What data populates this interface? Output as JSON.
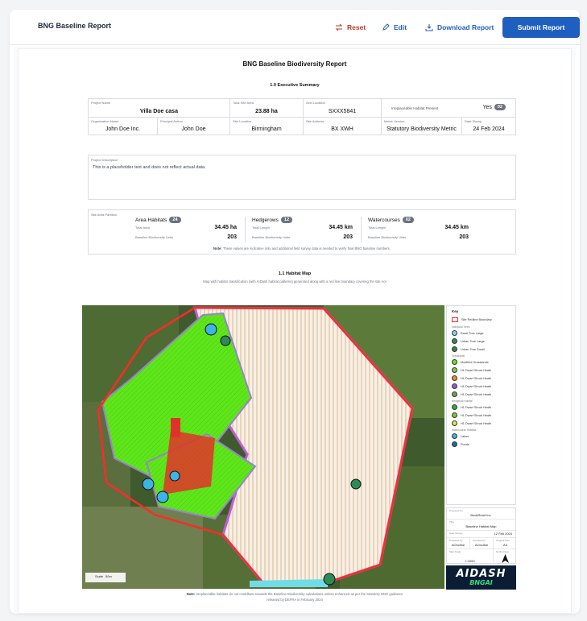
{
  "header": {
    "title": "BNG Baseline Report",
    "reset_label": "Reset",
    "edit_label": "Edit",
    "download_label": "Download Report",
    "submit_label": "Submit Report",
    "reset_color": "#c0392b",
    "accent_color": "#1f5fbf"
  },
  "report": {
    "title": "BNG Baseline Biodiversity Report",
    "section_exec": "1.0 Executive Summary",
    "project_name_label": "Project Name",
    "project_name": "Villa Doe casa",
    "total_site_area_label": "Total Site Area",
    "total_site_area": "23.88 ha",
    "grid_location_label": "Grid Location",
    "grid_location": "SXXX5841",
    "irreplaceable_label": "Irreplaceable Habitat Present",
    "irreplaceable_value": "Yes",
    "irreplaceable_count": "02",
    "org_name_label": "Organisation Name",
    "org_name": "John Doe Inc.",
    "principal_author_label": "Principal Author",
    "principal_author": "John Doe",
    "site_location_label": "Site Location",
    "site_location": "Birmingham",
    "site_address_label": "Site Address",
    "site_address": "BX XWH",
    "metric_version_label": "Metric Version",
    "metric_version": "Statutory Biodiversity Metric",
    "date_stamp_label": "Date Stamp",
    "date_stamp": "24 Feb 2024",
    "project_desc_label": "Project Description",
    "project_desc": "This is a placeholder text and does not reflect actual data.",
    "site_partition_label": "Site Area Partition",
    "partition": {
      "area_title": "Area Habitats",
      "area_count": "24",
      "area_sub1": "Total Area",
      "area_val1": "34.45 ha",
      "area_sub2": "Baseline Biodiversity Units",
      "area_val2": "203",
      "hedge_title": "Hedgerows",
      "hedge_count": "12",
      "hedge_sub1": "Total Length",
      "hedge_val1": "34.45 km",
      "hedge_sub2": "Baseline Biodiversity Units",
      "hedge_val2": "203",
      "water_title": "Watercourses",
      "water_count": "02",
      "water_sub1": "Total Length",
      "water_val1": "34.45 km",
      "water_sub2": "Baseline Biodiversity Units",
      "water_val2": "203",
      "note_bold": "Note:",
      "note": " These values are indicative only and additional field survey data is needed to verify final BNG baseline numbers."
    },
    "section_map": "1.1 Habitat Map",
    "map_sub": "Map with habitat classification (with AIDash habitat patterns) generated along with a red line boundary covering the site AoI",
    "map_note_bold": "Note:",
    "map_note_line1": " Irreplaceable habitats do not contribute towards the Baseline Biodiversity calculations unless enhanced as per the Statutory BNG guidance",
    "map_note_line2": "released by DEFRA in February 2024",
    "scale_label": "Scale",
    "scale_value": "50m"
  },
  "legend": {
    "title": "Key",
    "boundary": "Site Redline Boundary",
    "cat_individual": "Individual Trees",
    "tree1": "Rural Tree Large",
    "tree2": "Urban Tree Large",
    "tree3": "Urban Tree Small",
    "cat_grass": "Grasslands",
    "grass1": "Modified Grasslands",
    "grass2": "H1 Dwarf Shrub Heath",
    "grass3": "H1 Dwarf Shrub Heath",
    "grass4": "H1 Dwarf Shrub Heath",
    "grass5": "H1 Dwarf Shrub Heath",
    "cat_hedge": "Hedgerow Habitat",
    "hedge1": "H1 Dwarf Shrub Heath",
    "hedge2": "H1 Dwarf Shrub Heath",
    "hedge3": "H1 Dwarf Shrub Heath",
    "cat_water": "Watercourse Habitats",
    "water1": "Lakes",
    "water2": "Ponds"
  },
  "info": {
    "prepared_by_label": "Prepared for",
    "prepared_by": "BookRead Inc.",
    "title_label": "Title",
    "title": "Baseline Habitat Map",
    "date_label": "Date Survey",
    "date": "12 Feb 2024",
    "c1_label": "Prepared by",
    "c1": "AOncline",
    "c2_label": "Checked by",
    "c2": "AOncline",
    "c3_label": "Original Size",
    "c3": "A3",
    "ref_label": "Map Scale",
    "ref": "1:1000",
    "north_label": "North Arrow"
  },
  "logo": {
    "top": "AIDASH",
    "bottom": "BNGAI"
  }
}
